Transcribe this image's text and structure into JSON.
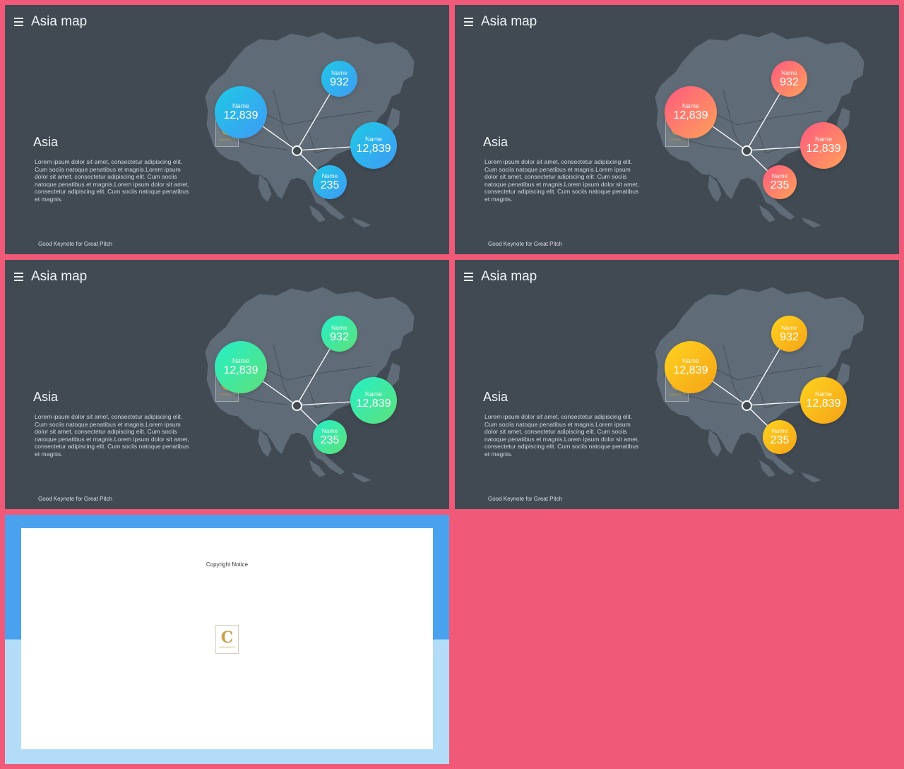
{
  "slides": [
    {
      "title": "Asia map",
      "region": "Asia",
      "body": "Lorem ipsum dolor sit amet, consectetur adipiscing elit. Cum sociis natoque penatibus et magnis.Lorem ipsum dolor sit amet, consectetur adipiscing elit. Cum sociis natoque penatibus et magnis.Lorem ipsum dolor sit amet, consectetur adipiscing elit. Cum sociis natoque penatibus et magnis.",
      "footer": "Good Keynote for Great Pitch",
      "theme": {
        "from": "#1ec9e6",
        "to": "#3f9bf4"
      },
      "bubbles": [
        {
          "label": "Name",
          "value": "12,839"
        },
        {
          "label": "Name",
          "value": "932"
        },
        {
          "label": "Name",
          "value": "12,839"
        },
        {
          "label": "Name",
          "value": "235"
        }
      ]
    },
    {
      "title": "Asia map",
      "region": "Asia",
      "body": "Lorem ipsum dolor sit amet, consectetur adipiscing elit. Cum sociis natoque penatibus et magnis.Lorem ipsum dolor sit amet, consectetur adipiscing elit. Cum sociis natoque penatibus et magnis.Lorem ipsum dolor sit amet, consectetur adipiscing elit. Cum sociis natoque penatibus et magnis.",
      "footer": "Good Keynote for Great Pitch",
      "theme": {
        "from": "#ff5a7e",
        "to": "#ffa15a"
      },
      "bubbles": [
        {
          "label": "Name",
          "value": "12,839"
        },
        {
          "label": "Name",
          "value": "932"
        },
        {
          "label": "Name",
          "value": "12,839"
        },
        {
          "label": "Name",
          "value": "235"
        }
      ]
    },
    {
      "title": "Asia map",
      "region": "Asia",
      "body": "Lorem ipsum dolor sit amet, consectetur adipiscing elit. Cum sociis natoque penatibus et magnis.Lorem ipsum dolor sit amet, consectetur adipiscing elit. Cum sociis natoque penatibus et magnis.Lorem ipsum dolor sit amet, consectetur adipiscing elit. Cum sociis natoque penatibus et magnis.",
      "footer": "Good Keynote for Great Pitch",
      "theme": {
        "from": "#24f0c8",
        "to": "#5ee07a"
      },
      "bubbles": [
        {
          "label": "Name",
          "value": "12,839"
        },
        {
          "label": "Name",
          "value": "932"
        },
        {
          "label": "Name",
          "value": "12,839"
        },
        {
          "label": "Name",
          "value": "235"
        }
      ]
    },
    {
      "title": "Asia map",
      "region": "Asia",
      "body": "Lorem ipsum dolor sit amet, consectetur adipiscing elit. Cum sociis natoque penatibus et magnis.Lorem ipsum dolor sit amet, consectetur adipiscing elit. Cum sociis natoque penatibus et magnis.Lorem ipsum dolor sit amet, consectetur adipiscing elit. Cum sociis natoque penatibus et magnis.",
      "footer": "Good Keynote for Great Pitch",
      "theme": {
        "from": "#ffd31e",
        "to": "#f5a318"
      },
      "bubbles": [
        {
          "label": "Name",
          "value": "12,839"
        },
        {
          "label": "Name",
          "value": "932"
        },
        {
          "label": "Name",
          "value": "12,839"
        },
        {
          "label": "Name",
          "value": "235"
        }
      ]
    }
  ],
  "logo": {
    "letter": "C",
    "text": "CONTENTS"
  },
  "copyright": {
    "title": "Copyright Notice"
  },
  "colors": {
    "background": "#f05a78",
    "slide": "#414a53",
    "map": "#5f6b76"
  }
}
